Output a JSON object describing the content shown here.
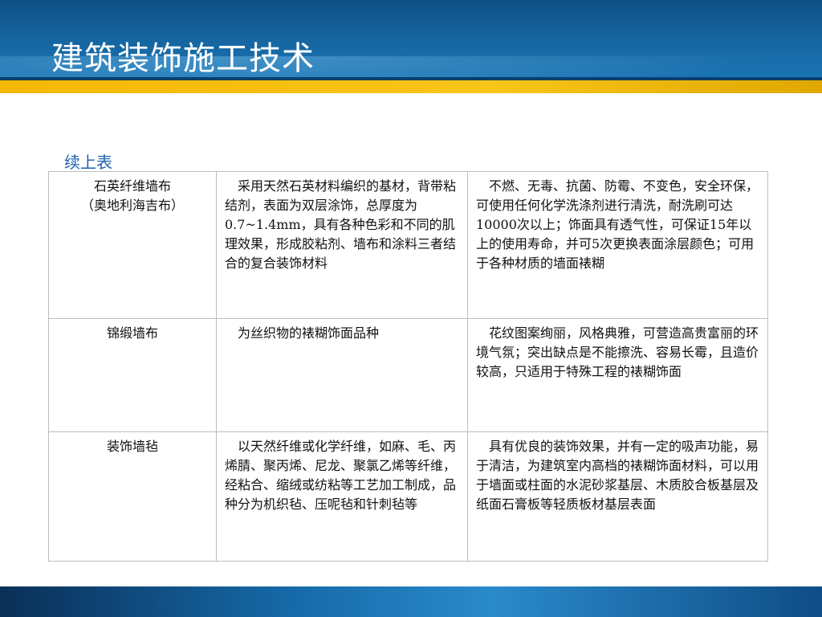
{
  "header": {
    "title": "建筑装饰施工技术"
  },
  "continued_label": "续上表",
  "table": {
    "rows": [
      {
        "name_line1": "石英纤维墙布",
        "name_line2": "（奥地利海吉布）",
        "description": "采用天然石英材料编织的基材，背带粘结剂，表面为双层涂饰，总厚度为0.7~1.4mm，具有各种色彩和不同的肌理效果，形成胶粘剂、墙布和涂料三者结合的复合装饰材料",
        "features": "不燃、无毒、抗菌、防霉、不变色，安全环保，可使用任何化学洗涤剂进行清洗，耐洗刷可达10000次以上；饰面具有透气性，可保证15年以上的使用寿命，并可5次更换表面涂层颜色；可用于各种材质的墙面裱糊"
      },
      {
        "name_line1": "锦缎墙布",
        "name_line2": "",
        "description": "为丝织物的裱糊饰面品种",
        "features": "花纹图案绚丽，风格典雅，可营造高贵富丽的环境气氛；突出缺点是不能擦洗、容易长霉，且造价较高，只适用于特殊工程的裱糊饰面"
      },
      {
        "name_line1": "装饰墙毡",
        "name_line2": "",
        "description": "以天然纤维或化学纤维，如麻、毛、丙烯腈、聚丙烯、尼龙、聚氯乙烯等纤维，经粘合、缩绒或纺粘等工艺加工制成，品种分为机织毡、压呢毡和针刺毡等",
        "features": "具有优良的装饰效果，并有一定的吸声功能，易于清洁，为建筑室内高档的裱糊饰面材料，可以用于墙面或柱面的水泥砂浆基层、木质胶合板基层及纸面石膏板等轻质板材基层表面"
      }
    ]
  }
}
